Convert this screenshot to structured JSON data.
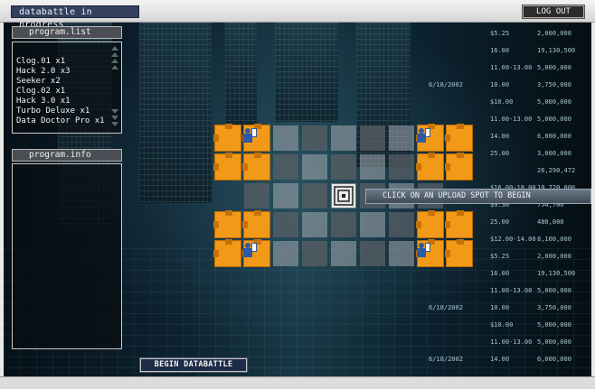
{
  "window": {
    "title": "databattle in progress",
    "logout_label": "LOG OUT"
  },
  "program_list": {
    "header": "program.list",
    "items": [
      "Clog.01 x1",
      "Hack 2.0 x3",
      "Seeker x2",
      "Clog.02 x1",
      "Hack 3.0 x1",
      "Turbo Deluxe x1",
      "Data Doctor Pro x1"
    ]
  },
  "program_info": {
    "header": "program.info"
  },
  "board": {
    "hint": "CLICK ON AN UPLOAD SPOT TO BEGIN"
  },
  "actions": {
    "begin_label": "BEGIN DATABATTLE"
  },
  "ticker": {
    "rows": [
      [
        "",
        "$5.25",
        "2,000,000"
      ],
      [
        "",
        "16.00",
        "19,130,500"
      ],
      [
        "",
        "11.00-13.00",
        "5,000,000"
      ],
      [
        "6/18/2002",
        "10.00",
        "3,750,000"
      ],
      [
        "",
        "$10.00",
        "5,000,000"
      ],
      [
        "",
        "11.00-13.00",
        "5,000,000"
      ],
      [
        "6/18/2002",
        "14.00",
        "6,000,000"
      ],
      [
        "",
        "25.00",
        "3,000,000"
      ],
      [
        "",
        "",
        "26,290,472"
      ],
      [
        "",
        "$16.00-18.00",
        "10,720,000"
      ],
      [
        "",
        "$9.30",
        "754,700"
      ],
      [
        "",
        "25.00",
        "480,000"
      ],
      [
        "",
        "$12.00-14.00",
        "8,100,000"
      ],
      [
        "",
        "$5.25",
        "2,000,000"
      ],
      [
        "",
        "16.00",
        "19,130,500"
      ],
      [
        "",
        "11.00-13.00",
        "5,000,000"
      ],
      [
        "6/18/2002",
        "10.00",
        "3,750,000"
      ],
      [
        "",
        "$10.00",
        "5,000,000"
      ],
      [
        "",
        "11.00-13.00",
        "5,000,000"
      ],
      [
        "6/18/2002",
        "14.00",
        "6,000,000"
      ]
    ]
  },
  "colors": {
    "upload_spot": "#f29a18",
    "title_bg": "#33415e",
    "begin_bg": "#1c2b46"
  }
}
